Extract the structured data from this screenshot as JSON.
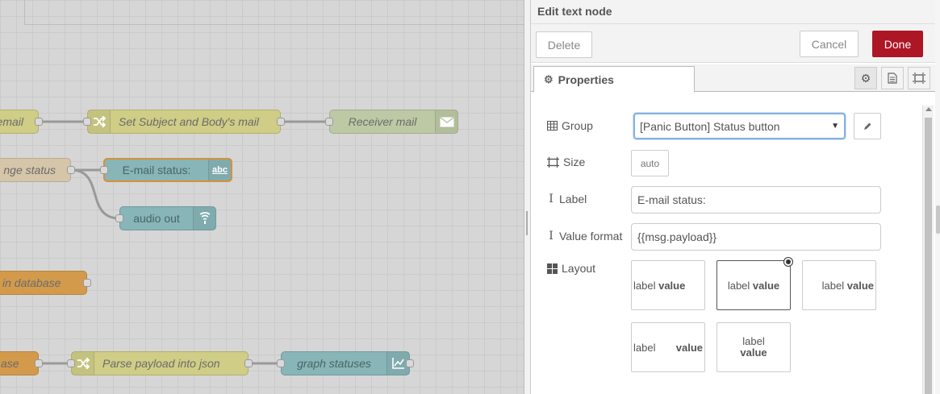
{
  "canvas": {
    "nodes": [
      {
        "id": "n_email",
        "label": "email",
        "style": "n-yellow"
      },
      {
        "id": "n_setsubject",
        "label": "Set Subject and Body's mail",
        "style": "n-yellow",
        "icon": "shuffle-icon"
      },
      {
        "id": "n_receiver",
        "label": "Receiver mail",
        "style": "n-green",
        "icon": "envelope-icon"
      },
      {
        "id": "n_change",
        "label": "nge status",
        "style": "n-peach"
      },
      {
        "id": "n_emailstatus",
        "label": "E-mail status:",
        "style": "n-teal",
        "icon": "abc-icon",
        "icon_text": "abc"
      },
      {
        "id": "n_audio",
        "label": "audio out",
        "style": "n-teal",
        "icon": "audio-icon"
      },
      {
        "id": "n_database",
        "label": "in database",
        "style": "n-orange"
      },
      {
        "id": "n_ase",
        "label": "ase",
        "style": "n-orange"
      },
      {
        "id": "n_parse",
        "label": "Parse payload into json",
        "style": "n-yellow",
        "icon": "shuffle-icon"
      },
      {
        "id": "n_graph",
        "label": "graph statuses",
        "style": "n-teal",
        "icon": "chart-icon"
      }
    ]
  },
  "tray": {
    "title": "Edit text node",
    "delete_label": "Delete",
    "cancel_label": "Cancel",
    "done_label": "Done",
    "tab_properties": "Properties",
    "group_label": "Group",
    "group_value": "[Panic Button] Status button",
    "size_label": "Size",
    "size_value": "auto",
    "label_label": "Label",
    "label_value": "E-mail status:",
    "format_label": "Value format",
    "format_value": "{{msg.payload}}",
    "layout_label": "Layout",
    "layouts": [
      {
        "label": "label",
        "value": "value",
        "selected": false
      },
      {
        "label": "label",
        "value": "value",
        "selected": true
      },
      {
        "label": "label",
        "value": "value",
        "selected": false
      },
      {
        "label": "label",
        "value": "value",
        "selected": false
      },
      {
        "label": "label",
        "value": "value",
        "selected": false
      }
    ]
  },
  "colors": {
    "done_button": "#ad1625",
    "selected_node_border": "#d99037",
    "select_focus": "#85b0e0"
  }
}
